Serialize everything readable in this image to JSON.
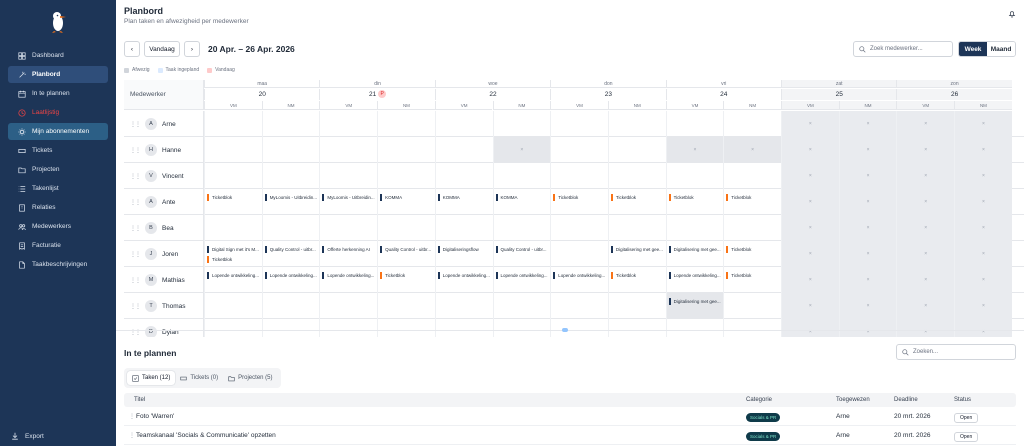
{
  "sidebar": {
    "items": [
      {
        "label": "Dashboard",
        "icon": "grid-icon"
      },
      {
        "label": "Planbord",
        "icon": "wand-icon"
      },
      {
        "label": "In te plannen",
        "icon": "calendar-icon"
      },
      {
        "label": "Laatlijstig",
        "icon": "clock-icon"
      },
      {
        "label": "Mijn abonnementen",
        "icon": "gear-icon"
      },
      {
        "label": "Tickets",
        "icon": "ticket-icon"
      },
      {
        "label": "Projecten",
        "icon": "folder-icon"
      },
      {
        "label": "Takenlijst",
        "icon": "list-icon"
      },
      {
        "label": "Relaties",
        "icon": "building-icon"
      },
      {
        "label": "Medewerkers",
        "icon": "users-icon"
      },
      {
        "label": "Facturatie",
        "icon": "invoice-icon"
      },
      {
        "label": "Taakbeschrijvingen",
        "icon": "document-icon"
      }
    ],
    "export_label": "Export"
  },
  "header": {
    "title": "Planbord",
    "subtitle": "Plan taken en afwezigheid per medewerker"
  },
  "toolbar": {
    "prev": "‹",
    "today": "Vandaag",
    "next": "›",
    "range": "20 Apr. – 26 Apr. 2026",
    "search_placeholder": "Zoek medewerker...",
    "view_week": "Week",
    "view_month": "Maand"
  },
  "legend": {
    "items": [
      {
        "label": "Afwezig",
        "color": "#d1d5db"
      },
      {
        "label": "Taak ingepland",
        "color": "#dbeafe"
      },
      {
        "label": "Vandaag",
        "color": "#fecaca"
      }
    ]
  },
  "grid": {
    "employee_header": "Medewerker",
    "holiday_badge": "P",
    "days": [
      {
        "name": "maa",
        "num": "20"
      },
      {
        "name": "din",
        "num": "21"
      },
      {
        "name": "woe",
        "num": "22"
      },
      {
        "name": "don",
        "num": "23"
      },
      {
        "name": "vri",
        "num": "24"
      },
      {
        "name": "zat",
        "num": "25"
      },
      {
        "name": "zon",
        "num": "26"
      }
    ],
    "am": "VM",
    "pm": "NM",
    "absent_mark": "×",
    "employees": [
      {
        "initial": "A",
        "name": "Arne"
      },
      {
        "initial": "H",
        "name": "Hanne"
      },
      {
        "initial": "V",
        "name": "Vincent"
      },
      {
        "initial": "A",
        "name": "Ante"
      },
      {
        "initial": "B",
        "name": "Bea"
      },
      {
        "initial": "J",
        "name": "Joren"
      },
      {
        "initial": "M",
        "name": "Mathias"
      },
      {
        "initial": "T",
        "name": "Thomas"
      },
      {
        "initial": "D",
        "name": "Dylan"
      }
    ],
    "tasks": [
      {
        "row": 3,
        "slot": 0,
        "line": 0,
        "text": "Ticketblok",
        "color": "orange"
      },
      {
        "row": 3,
        "slot": 1,
        "line": 0,
        "text": "MyLoomis - Uitbreidin...",
        "color": "navy"
      },
      {
        "row": 3,
        "slot": 2,
        "line": 0,
        "text": "MyLoomis - Uitbreidin...",
        "color": "navy"
      },
      {
        "row": 3,
        "slot": 3,
        "line": 0,
        "text": "KOMMA",
        "color": "navy"
      },
      {
        "row": 3,
        "slot": 4,
        "line": 0,
        "text": "KOMMA",
        "color": "navy"
      },
      {
        "row": 3,
        "slot": 5,
        "line": 0,
        "text": "KOMMA",
        "color": "navy"
      },
      {
        "row": 3,
        "slot": 6,
        "line": 0,
        "text": "Ticketblok",
        "color": "orange"
      },
      {
        "row": 3,
        "slot": 7,
        "line": 0,
        "text": "Ticketblok",
        "color": "orange"
      },
      {
        "row": 3,
        "slot": 8,
        "line": 0,
        "text": "Ticketblok",
        "color": "orange"
      },
      {
        "row": 3,
        "slot": 9,
        "line": 0,
        "text": "Ticketblok",
        "color": "orange"
      },
      {
        "row": 5,
        "slot": 0,
        "line": 0,
        "text": "Digital Sign met it's M...",
        "color": "navy"
      },
      {
        "row": 5,
        "slot": 0,
        "line": 1,
        "text": "Ticketblok",
        "color": "orange"
      },
      {
        "row": 5,
        "slot": 1,
        "line": 0,
        "text": "Quality Control - uitbr...",
        "color": "navy"
      },
      {
        "row": 5,
        "slot": 2,
        "line": 0,
        "text": "Offerte herkenning AI",
        "color": "navy"
      },
      {
        "row": 5,
        "slot": 3,
        "line": 0,
        "text": "Quality Control - uitbr...",
        "color": "navy"
      },
      {
        "row": 5,
        "slot": 4,
        "line": 0,
        "text": "Digitaliseringsflow",
        "color": "navy"
      },
      {
        "row": 5,
        "slot": 5,
        "line": 0,
        "text": "Quality Control - uitbr...",
        "color": "navy"
      },
      {
        "row": 5,
        "slot": 7,
        "line": 0,
        "text": "Digitalisering met gee...",
        "color": "navy"
      },
      {
        "row": 5,
        "slot": 8,
        "line": 0,
        "text": "Digitalisering met gee...",
        "color": "navy"
      },
      {
        "row": 5,
        "slot": 9,
        "line": 0,
        "text": "Ticketblok",
        "color": "orange"
      },
      {
        "row": 6,
        "slot": 0,
        "line": 0,
        "text": "Lopende ontwikkeling...",
        "color": "navy"
      },
      {
        "row": 6,
        "slot": 1,
        "line": 0,
        "text": "Lopende ontwikkeling...",
        "color": "navy"
      },
      {
        "row": 6,
        "slot": 2,
        "line": 0,
        "text": "Lopende ontwikkeling...",
        "color": "navy"
      },
      {
        "row": 6,
        "slot": 3,
        "line": 0,
        "text": "Ticketblok",
        "color": "orange"
      },
      {
        "row": 6,
        "slot": 4,
        "line": 0,
        "text": "Lopende ontwikkeling...",
        "color": "navy"
      },
      {
        "row": 6,
        "slot": 5,
        "line": 0,
        "text": "Lopende ontwikkeling...",
        "color": "navy"
      },
      {
        "row": 6,
        "slot": 6,
        "line": 0,
        "text": "Lopende ontwikkeling...",
        "color": "navy"
      },
      {
        "row": 6,
        "slot": 7,
        "line": 0,
        "text": "Ticketblok",
        "color": "orange"
      },
      {
        "row": 6,
        "slot": 8,
        "line": 0,
        "text": "Lopende ontwikkeling...",
        "color": "navy"
      },
      {
        "row": 6,
        "slot": 9,
        "line": 0,
        "text": "Ticketblok",
        "color": "orange"
      },
      {
        "row": 7,
        "slot": 8,
        "line": 0,
        "text": "Digitalisering met gee...",
        "color": "navy"
      }
    ],
    "absences": [
      {
        "row": 1,
        "slot": 5
      },
      {
        "row": 1,
        "slot": 8
      },
      {
        "row": 1,
        "slot": 9
      },
      {
        "row": 7,
        "slot": 8
      }
    ]
  },
  "bottom": {
    "title": "In te plannen",
    "search_placeholder": "Zoeken...",
    "tabs": [
      {
        "label": "Taken (12)",
        "icon": "check-square-icon"
      },
      {
        "label": "Tickets (0)",
        "icon": "ticket-icon"
      },
      {
        "label": "Projecten (5)",
        "icon": "folder-icon"
      }
    ],
    "columns": [
      "Titel",
      "Categorie",
      "Toegewezen",
      "Deadline",
      "Status"
    ],
    "rows": [
      {
        "title": "Foto 'Warren'",
        "category": "Socials & PR",
        "assigned": "Arne",
        "deadline": "20 mrt. 2026",
        "status": "Open"
      },
      {
        "title": "Teamskanaal 'Socials & Communicatie' opzetten",
        "category": "Socials & PR",
        "assigned": "Arne",
        "deadline": "20 mrt. 2026",
        "status": "Open"
      }
    ]
  },
  "colors": {
    "sidebar": "#1d3557",
    "accent": "#1d3557",
    "task_navy": "#1d3557",
    "task_orange": "#f97316",
    "danger": "#ef4444"
  }
}
